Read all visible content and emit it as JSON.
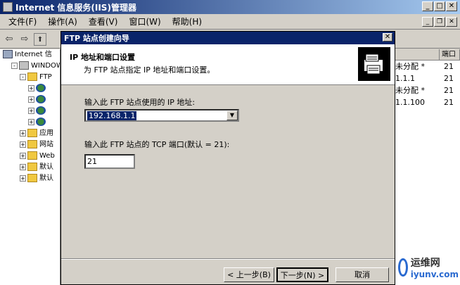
{
  "window": {
    "title": "Internet 信息服务(IIS)管理器",
    "min": "_",
    "max": "□",
    "close": "✕"
  },
  "menu": [
    {
      "label": "文件(F)"
    },
    {
      "label": "操作(A)"
    },
    {
      "label": "查看(V)"
    },
    {
      "label": "窗口(W)"
    },
    {
      "label": "帮助(H)"
    }
  ],
  "mdi": {
    "min": "_",
    "restore": "❐",
    "close": "✕"
  },
  "toolbar": {
    "back": "⇦",
    "forward": "⇨",
    "up": "⬆"
  },
  "tree": [
    {
      "label": "Internet 信",
      "icon": "computer-icon",
      "indent": 0,
      "expander": ""
    },
    {
      "label": "WINDOWS",
      "icon": "server-icon",
      "indent": 1,
      "expander": "-"
    },
    {
      "label": "FTP",
      "icon": "folder-icon",
      "indent": 2,
      "expander": "-"
    },
    {
      "label": "",
      "icon": "globe-icon",
      "indent": 3,
      "expander": "+"
    },
    {
      "label": "",
      "icon": "globe-icon",
      "indent": 3,
      "expander": "+"
    },
    {
      "label": "",
      "icon": "globe-icon",
      "indent": 3,
      "expander": "+"
    },
    {
      "label": "",
      "icon": "globe-icon",
      "indent": 3,
      "expander": "+"
    },
    {
      "label": "应用",
      "icon": "folder-icon",
      "indent": 2,
      "expander": "+"
    },
    {
      "label": "网站",
      "icon": "folder-icon",
      "indent": 2,
      "expander": "+"
    },
    {
      "label": "Web",
      "icon": "folder-icon",
      "indent": 2,
      "expander": "+"
    },
    {
      "label": "默认",
      "icon": "folder-icon",
      "indent": 2,
      "expander": "+"
    },
    {
      "label": "默认",
      "icon": "folder-icon",
      "indent": 2,
      "expander": "+"
    }
  ],
  "list": {
    "col_port": "端口",
    "rows": [
      {
        "a": "未分配 *",
        "b": "21"
      },
      {
        "a": "1.1.1",
        "b": "21"
      },
      {
        "a": "未分配 *",
        "b": "21"
      },
      {
        "a": "1.1.100",
        "b": "21"
      }
    ]
  },
  "dialog": {
    "title": "FTP 站点创建向导",
    "close": "✕",
    "heading": "IP 地址和端口设置",
    "subheading": "为 FTP 站点指定 IP 地址和端口设置。",
    "ip_label": "输入此 FTP 站点使用的 IP 地址:",
    "ip_value": "192.168.1.1",
    "port_label": "输入此 FTP 站点的 TCP 端口(默认 = 21):",
    "port_value": "21",
    "back_button": "< 上一步(B)",
    "next_button": "下一步(N) >",
    "cancel_button": "取消"
  },
  "watermark": {
    "line1": "运维网",
    "line2": "iyunv.com"
  }
}
